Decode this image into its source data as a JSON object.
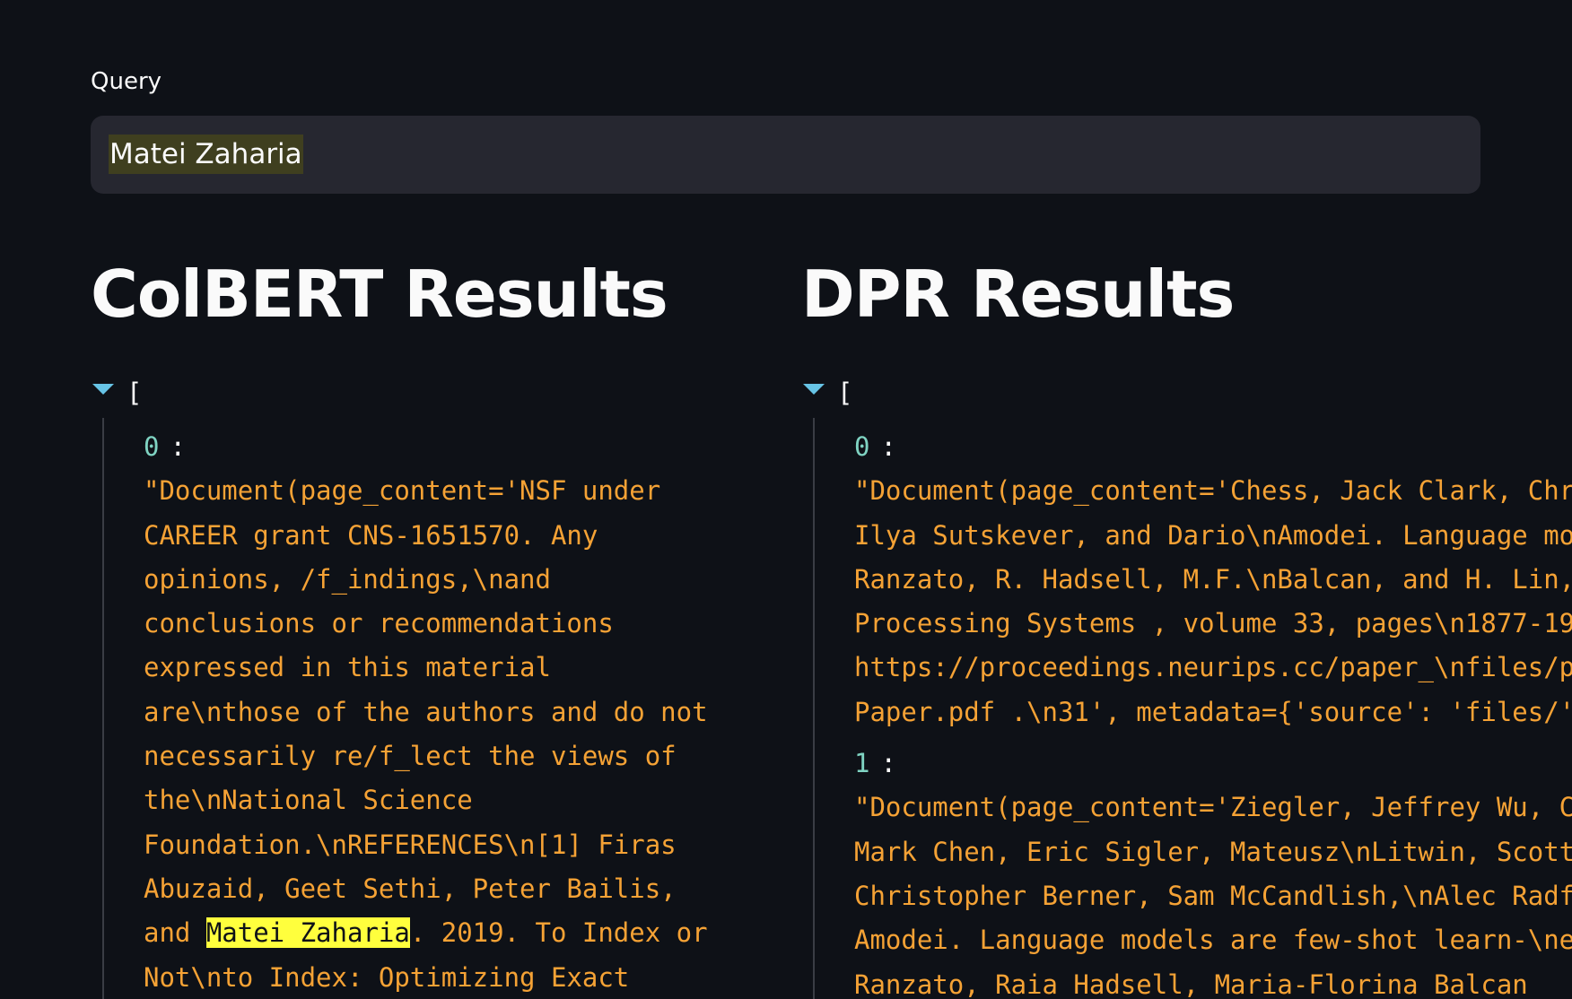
{
  "query": {
    "label": "Query",
    "value": "Matei Zaharia"
  },
  "colbert": {
    "title": "ColBERT Results",
    "open_bracket": "[",
    "items": [
      {
        "index": "0",
        "lines_before": "\"Document(page_content='NSF under\nCAREER grant CNS-1651570. Any\nopinions, /f_indings,\\nand\nconclusions or recommendations\nexpressed in this material\nare\\nthose of the authors and do not\nnecessarily re/f_lect the views of\nthe\\nNational Science\nFoundation.\\nREFERENCES\\n[1] Firas\nAbuzaid, Geet Sethi, Peter Bailis,\nand ",
        "highlight": "Matei Zaharia",
        "lines_after": ". 2019. To Index or\nNot\\nto Index: Optimizing Exact"
      }
    ]
  },
  "dpr": {
    "title": "DPR Results",
    "open_bracket": "[",
    "items": [
      {
        "index": "0",
        "text": "\"Document(page_content='Chess, Jack Clark, Christopher Berner,\nIlya Sutskever, and Dario\\nAmodei. Language models are few-shot\nRanzato, R. Hadsell, M.F.\\nBalcan, and H. Lin, editors,\nProcessing Systems , volume 33, pages\\n1877-1901. Curran\nhttps://proceedings.neurips.cc/paper_\\nfiles/paper/2020/file/\nPaper.pdf .\\n31', metadata={'source': 'files/'"
      },
      {
        "index": "1",
        "text": "\"Document(page_content='Ziegler, Jeffrey Wu, Clemens Winter,\nMark Chen, Eric Sigler, Mateusz\\nLitwin, Scott Gray,\nChristopher Berner, Sam McCandlish,\\nAlec Radford,\nAmodei. Language models are few-shot learn-\\ners.\nRanzato, Raia Hadsell, Maria-Florina Balcan"
      }
    ]
  }
}
